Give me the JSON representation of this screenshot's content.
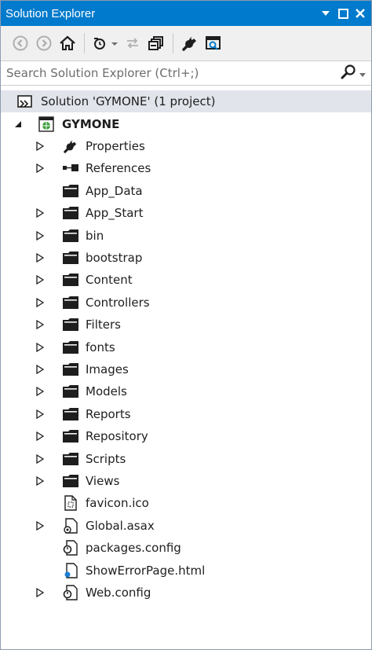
{
  "window": {
    "title": "Solution Explorer"
  },
  "search": {
    "placeholder": "Search Solution Explorer (Ctrl+;)"
  },
  "solution": {
    "label": "Solution 'GYMONE' (1 project)"
  },
  "project": {
    "label": "GYMONE"
  },
  "items": [
    {
      "label": "Properties",
      "icon": "wrench-icon",
      "expandable": true
    },
    {
      "label": "References",
      "icon": "references-icon",
      "expandable": true
    },
    {
      "label": "App_Data",
      "icon": "folder-icon",
      "expandable": false
    },
    {
      "label": "App_Start",
      "icon": "folder-icon",
      "expandable": true
    },
    {
      "label": "bin",
      "icon": "folder-icon",
      "expandable": true
    },
    {
      "label": "bootstrap",
      "icon": "folder-icon",
      "expandable": true
    },
    {
      "label": "Content",
      "icon": "folder-icon",
      "expandable": true
    },
    {
      "label": "Controllers",
      "icon": "folder-icon",
      "expandable": true
    },
    {
      "label": "Filters",
      "icon": "folder-icon",
      "expandable": true
    },
    {
      "label": "fonts",
      "icon": "folder-icon",
      "expandable": true
    },
    {
      "label": "Images",
      "icon": "folder-icon",
      "expandable": true
    },
    {
      "label": "Models",
      "icon": "folder-icon",
      "expandable": true
    },
    {
      "label": "Reports",
      "icon": "folder-icon",
      "expandable": true
    },
    {
      "label": "Repository",
      "icon": "folder-icon",
      "expandable": true
    },
    {
      "label": "Scripts",
      "icon": "folder-icon",
      "expandable": true
    },
    {
      "label": "Views",
      "icon": "folder-icon",
      "expandable": true
    },
    {
      "label": "favicon.ico",
      "icon": "image-file-icon",
      "expandable": false
    },
    {
      "label": "Global.asax",
      "icon": "asax-file-icon",
      "expandable": true
    },
    {
      "label": "packages.config",
      "icon": "config-file-icon",
      "expandable": false
    },
    {
      "label": "ShowErrorPage.html",
      "icon": "html-file-icon",
      "expandable": false
    },
    {
      "label": "Web.config",
      "icon": "config-file-icon",
      "expandable": true
    }
  ],
  "colors": {
    "titlebar": "#007acc",
    "toolbar": "#f0f0f0",
    "selection": "#e1e4ea",
    "text": "#1e1e1e"
  }
}
